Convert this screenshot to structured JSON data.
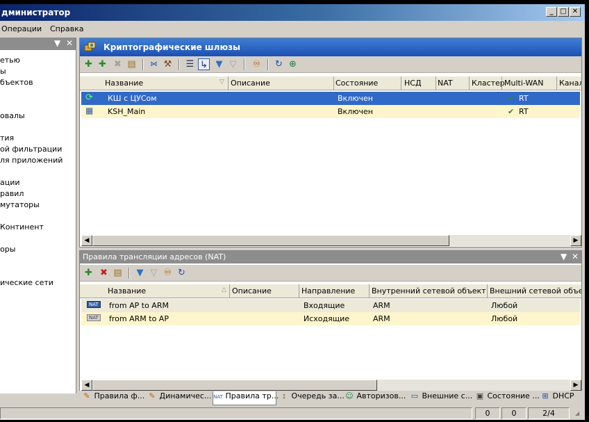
{
  "window": {
    "title": "дминистратор",
    "min_glyph": "_",
    "max_glyph": "□",
    "close_glyph": "✕"
  },
  "menu": [
    "Операции",
    "Справка"
  ],
  "left_pane": {
    "header_controls": [
      "▼",
      "✕"
    ],
    "items": [
      "етью",
      "ы",
      "бъектов",
      "",
      "",
      "овалы",
      "",
      "тия",
      "ой фильтрации",
      "ля приложений",
      "",
      "ации",
      "равил",
      "мутаторы",
      "",
      " Континент",
      "",
      "оры",
      "",
      "",
      "ические сети"
    ]
  },
  "gateways_panel": {
    "title": "Криптографические шлюзы",
    "toolbar_icons": [
      "add-gateway-icon",
      "add-cluster-icon",
      "delete-icon",
      "properties-icon",
      "connect-icon",
      "hammer-icon",
      "list-view-icon",
      "tree-view-icon",
      "filter-icon",
      "clear-filter-icon",
      "find-icon",
      "refresh-icon",
      "globe-icon"
    ],
    "columns": [
      "Название",
      "Описание",
      "Состояние",
      "НСД",
      "NAT",
      "Кластер",
      "Multi-WAN",
      "Канал"
    ],
    "rows": [
      {
        "icon": "cluster-gateway-icon",
        "name": "КШ с ЦУСом",
        "description": "",
        "state": "Включен",
        "nsd": "",
        "nat": "",
        "cluster": "",
        "multiwan_check": "✔",
        "multiwan": "RT",
        "selected": true
      },
      {
        "icon": "gateway-icon",
        "name": "KSH_Main",
        "description": "",
        "state": "Включен",
        "nsd": "",
        "nat": "",
        "cluster": "",
        "multiwan_check": "✔",
        "multiwan": "RT",
        "selected": false
      }
    ]
  },
  "nat_panel": {
    "title": "Правила трансляции адресов (NAT)",
    "header_controls": [
      "▼",
      "✕"
    ],
    "toolbar_icons": [
      "add-rule-icon",
      "delete-icon",
      "properties-icon",
      "filter-icon",
      "clear-filter-icon",
      "find-icon",
      "refresh-icon"
    ],
    "columns": [
      "Название",
      "Описание",
      "Направление",
      "Внутренний сетевой объект",
      "Внешний сетевой объект"
    ],
    "rows": [
      {
        "icon": "nat-icon",
        "name": "from AP to ARM",
        "description": "",
        "direction": "Входящие",
        "internal": "ARM",
        "external": "Любой"
      },
      {
        "icon": "nat-icon",
        "name": "from ARM to AP",
        "description": "",
        "direction": "Исходящие",
        "internal": "ARM",
        "external": "Любой"
      }
    ]
  },
  "tabs": [
    {
      "label": "Правила ф...",
      "icon": "filter-rules-icon"
    },
    {
      "label": "Динамичес...",
      "icon": "dynamic-rules-icon"
    },
    {
      "label": "Правила тр...",
      "icon": "nat-icon",
      "active": true
    },
    {
      "label": "Очередь за...",
      "icon": "queue-icon"
    },
    {
      "label": "Авторизов...",
      "icon": "auth-icon"
    },
    {
      "label": "Внешние с...",
      "icon": "external-icon"
    },
    {
      "label": "Состояние ...",
      "icon": "status-icon"
    },
    {
      "label": "DHCP",
      "icon": "dhcp-icon"
    }
  ],
  "status": {
    "fields": [
      "0",
      "0",
      "2/4"
    ]
  },
  "colors": {
    "selected_row": "#3169c6",
    "alt_row": "#fff5cc",
    "header_blue": "#1c50b3"
  }
}
